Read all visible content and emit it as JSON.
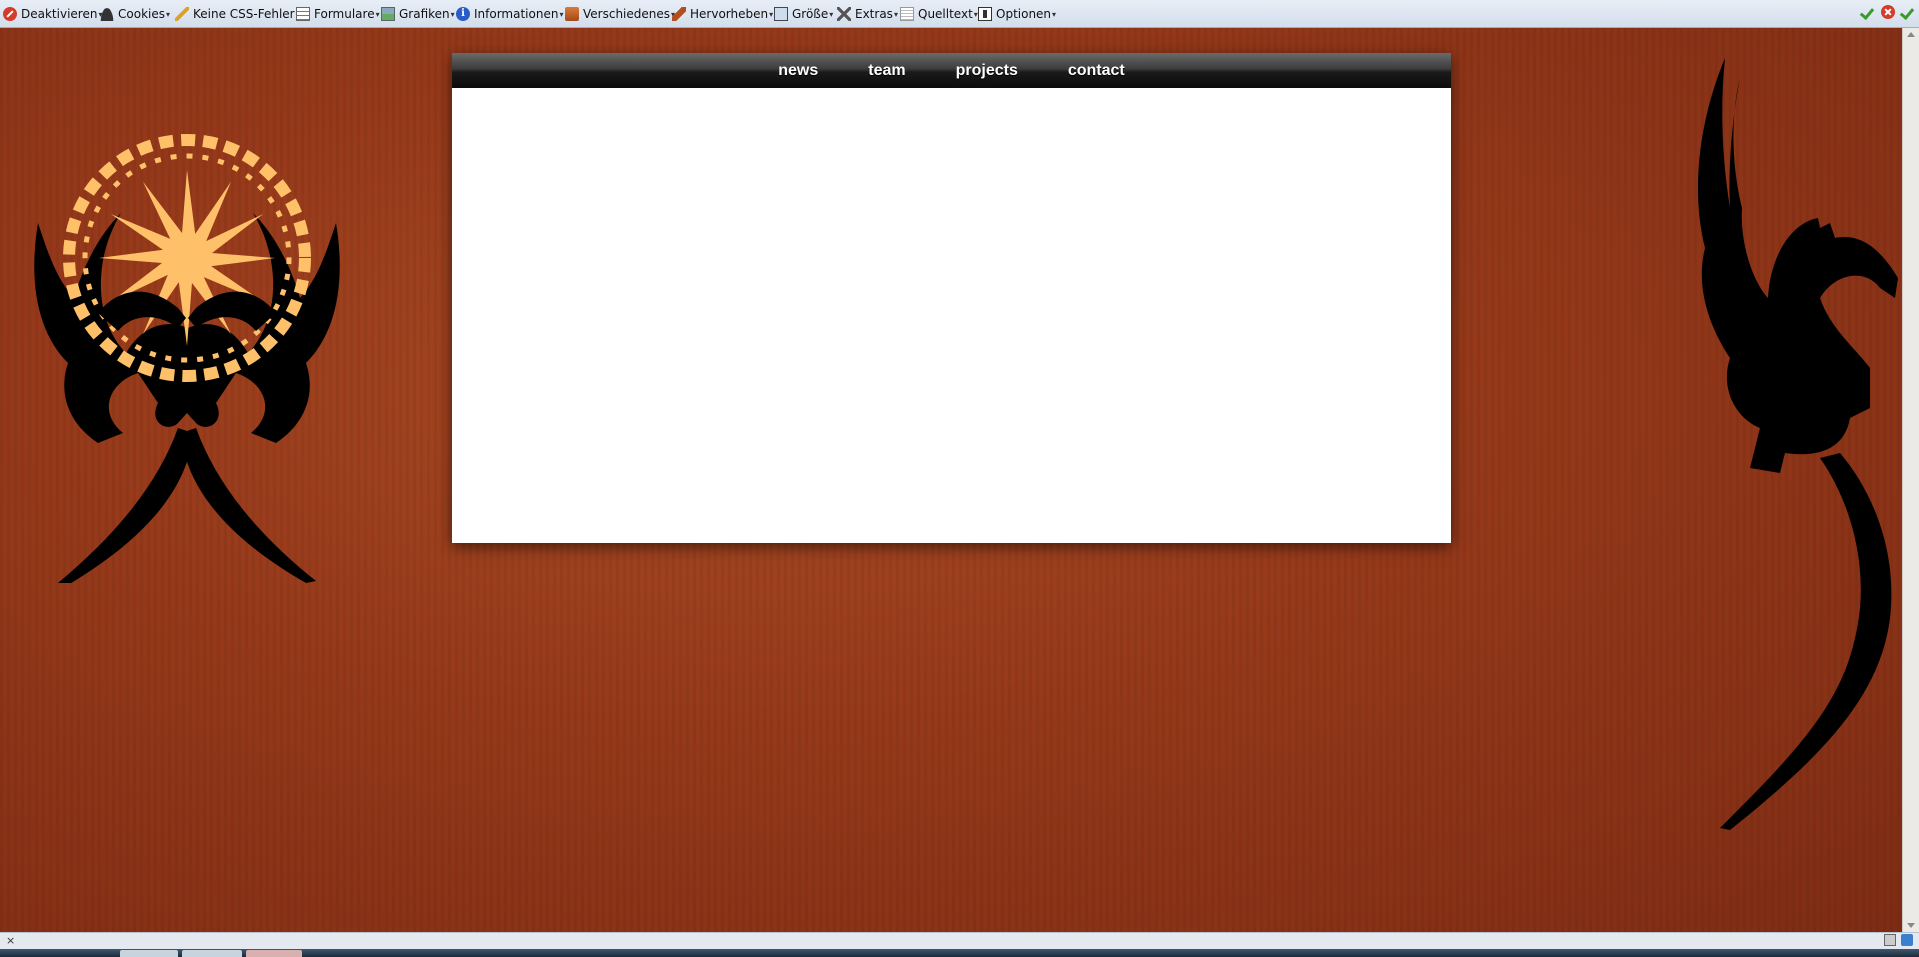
{
  "toolbar": {
    "items": [
      {
        "label": "Deaktivieren",
        "icon": "disable-icon"
      },
      {
        "label": "Cookies",
        "icon": "cookie-icon"
      },
      {
        "label": "Keine CSS-Fehler",
        "icon": "pencil-icon"
      },
      {
        "label": "Formulare",
        "icon": "form-icon"
      },
      {
        "label": "Grafiken",
        "icon": "image-icon"
      },
      {
        "label": "Informationen",
        "icon": "info-icon"
      },
      {
        "label": "Verschiedenes",
        "icon": "misc-icon"
      },
      {
        "label": "Hervorheben",
        "icon": "highlight-icon"
      },
      {
        "label": "Größe",
        "icon": "size-icon"
      },
      {
        "label": "Extras",
        "icon": "tools-icon"
      },
      {
        "label": "Quelltext",
        "icon": "source-icon"
      },
      {
        "label": "Optionen",
        "icon": "options-icon"
      }
    ],
    "right_icons": [
      "check-icon",
      "error-icon",
      "check-icon"
    ]
  },
  "nav": {
    "links": [
      "news",
      "team",
      "projects",
      "contact"
    ]
  },
  "colors": {
    "background": "#8e3418",
    "sun": "#ffc06a",
    "silhouette": "#000000",
    "navbar": "#1a1a1a",
    "content": "#ffffff"
  },
  "statusbar": {
    "close_label": "×"
  }
}
